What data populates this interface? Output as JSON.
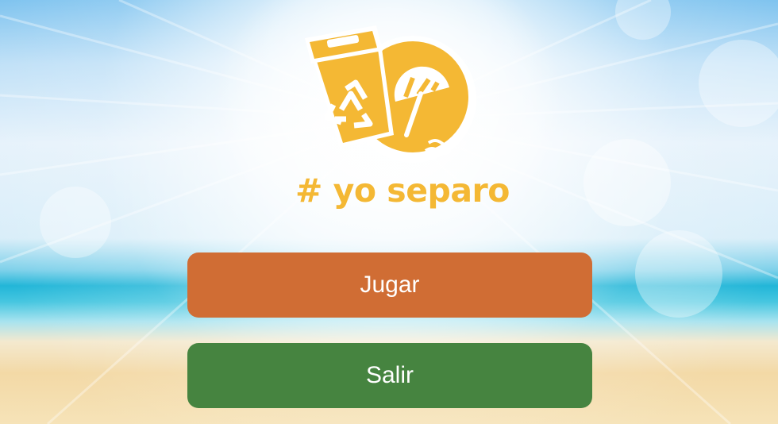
{
  "logo": {
    "text": "# yo separo",
    "icons": [
      "recycle-bin-icon",
      "recycle-symbol-icon",
      "beach-umbrella-icon"
    ],
    "color": "#f4b834"
  },
  "menu": {
    "play_label": "Jugar",
    "exit_label": "Salir",
    "play_color": "#d06d34",
    "exit_color": "#468440"
  }
}
